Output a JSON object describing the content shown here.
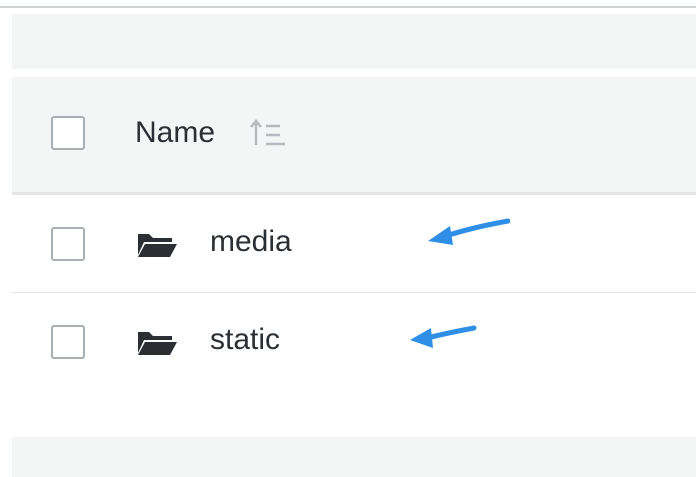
{
  "header": {
    "name_label": "Name",
    "sort_icon": "sort-ascending-icon"
  },
  "rows": [
    {
      "name": "media",
      "icon": "folder-open-icon",
      "annotated": true
    },
    {
      "name": "static",
      "icon": "folder-open-icon",
      "annotated": true
    }
  ],
  "colors": {
    "annotation_arrow": "#2f8fe6",
    "header_background": "#f4f5f5",
    "text": "#2b2f33",
    "checkbox_border": "#a9aeb2"
  }
}
